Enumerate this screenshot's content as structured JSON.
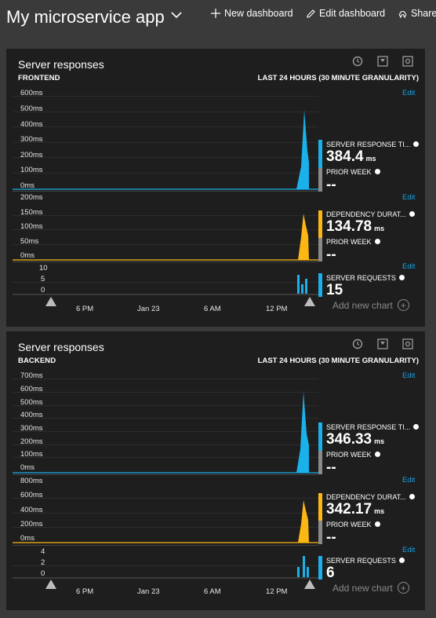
{
  "header": {
    "title": "My microservice app",
    "new_dashboard": "New dashboard",
    "edit_dashboard": "Edit dashboard",
    "share": "Share"
  },
  "colors": {
    "blue": "#1ab1ea",
    "yellow": "#fcb714",
    "grey": "#8a8a8a",
    "link": "#1aa1e3"
  },
  "panels": [
    {
      "title": "Server responses",
      "subtitle": "FRONTEND",
      "range": "LAST 24 HOURS (30 MINUTE GRANULARITY)",
      "edit1": "Edit",
      "edit2": "Edit",
      "edit3": "Edit",
      "x_ticks": [
        "6 PM",
        "Jan 23",
        "6 AM",
        "12 PM"
      ],
      "add_chart": "Add new chart",
      "chart1": {
        "ticks": [
          "600ms",
          "500ms",
          "400ms",
          "300ms",
          "200ms",
          "100ms",
          "0ms"
        ]
      },
      "chart2": {
        "ticks": [
          "200ms",
          "150ms",
          "100ms",
          "50ms",
          "0ms"
        ]
      },
      "chart3": {
        "ticks": [
          "10",
          "5",
          "0"
        ]
      },
      "legend": {
        "m1_name": "SERVER RESPONSE TI...",
        "m1_value": "384.4",
        "m1_unit": "ms",
        "p1_name": "PRIOR WEEK",
        "p1_value": "--",
        "m2_name": "DEPENDENCY DURAT...",
        "m2_value": "134.78",
        "m2_unit": "ms",
        "p2_name": "PRIOR WEEK",
        "p2_value": "--",
        "m3_name": "SERVER REQUESTS",
        "m3_value": "15"
      }
    },
    {
      "title": "Server responses",
      "subtitle": "BACKEND",
      "range": "LAST 24 HOURS (30 MINUTE GRANULARITY)",
      "edit1": "Edit",
      "edit2": "Edit",
      "edit3": "Edit",
      "x_ticks": [
        "6 PM",
        "Jan 23",
        "6 AM",
        "12 PM"
      ],
      "add_chart": "Add new chart",
      "chart1": {
        "ticks": [
          "700ms",
          "600ms",
          "500ms",
          "400ms",
          "300ms",
          "200ms",
          "100ms",
          "0ms"
        ]
      },
      "chart2": {
        "ticks": [
          "800ms",
          "600ms",
          "400ms",
          "200ms",
          "0ms"
        ]
      },
      "chart3": {
        "ticks": [
          "4",
          "2",
          "0"
        ]
      },
      "legend": {
        "m1_name": "SERVER RESPONSE TI...",
        "m1_value": "346.33",
        "m1_unit": "ms",
        "p1_name": "PRIOR WEEK",
        "p1_value": "--",
        "m2_name": "DEPENDENCY DURAT...",
        "m2_value": "342.17",
        "m2_unit": "ms",
        "p2_name": "PRIOR WEEK",
        "p2_value": "--",
        "m3_name": "SERVER REQUESTS",
        "m3_value": "6"
      }
    }
  ]
}
